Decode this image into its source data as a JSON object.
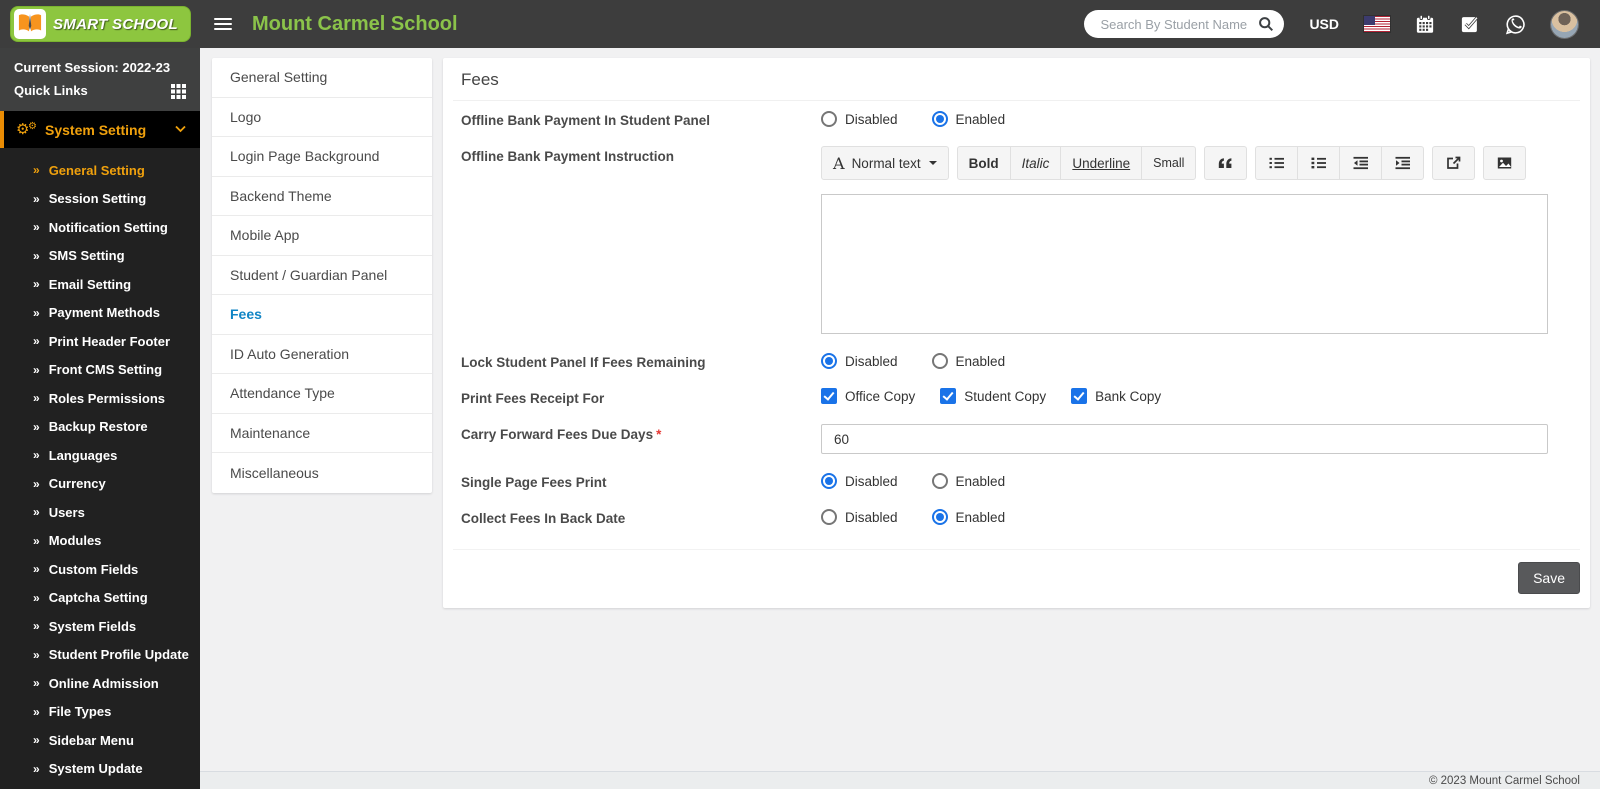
{
  "colors": {
    "header_bg": "#3d3d3d",
    "brand_green": "#8dc63f",
    "brand_orange": "#f7941e",
    "sidebar_bg": "#212121",
    "sidebar_accent_orange": "#f0a10d",
    "nav_active_blue": "#1185c5",
    "control_blue": "#1a73e8",
    "save_button_bg": "#58595b"
  },
  "header": {
    "brand": "SMART SCHOOL",
    "school_name": "Mount Carmel School",
    "search_placeholder": "Search By Student Name",
    "currency": "USD"
  },
  "sidebar": {
    "session_label": "Current Session: 2022-23",
    "quick_links_label": "Quick Links",
    "menu_title": "System Setting",
    "item_bullet": "»",
    "items": [
      {
        "label": "General Setting",
        "active": true
      },
      {
        "label": "Session Setting"
      },
      {
        "label": "Notification Setting"
      },
      {
        "label": "SMS Setting"
      },
      {
        "label": "Email Setting"
      },
      {
        "label": "Payment Methods"
      },
      {
        "label": "Print Header Footer"
      },
      {
        "label": "Front CMS Setting"
      },
      {
        "label": "Roles Permissions"
      },
      {
        "label": "Backup Restore"
      },
      {
        "label": "Languages"
      },
      {
        "label": "Currency"
      },
      {
        "label": "Users"
      },
      {
        "label": "Modules"
      },
      {
        "label": "Custom Fields"
      },
      {
        "label": "Captcha Setting"
      },
      {
        "label": "System Fields"
      },
      {
        "label": "Student Profile Update"
      },
      {
        "label": "Online Admission"
      },
      {
        "label": "File Types"
      },
      {
        "label": "Sidebar Menu"
      },
      {
        "label": "System Update"
      }
    ]
  },
  "settings_nav": {
    "items": [
      {
        "label": "General Setting"
      },
      {
        "label": "Logo"
      },
      {
        "label": "Login Page Background"
      },
      {
        "label": "Backend Theme"
      },
      {
        "label": "Mobile App"
      },
      {
        "label": "Student / Guardian Panel"
      },
      {
        "label": "Fees",
        "active": true
      },
      {
        "label": "ID Auto Generation"
      },
      {
        "label": "Attendance Type"
      },
      {
        "label": "Maintenance"
      },
      {
        "label": "Miscellaneous"
      }
    ]
  },
  "main": {
    "card_title": "Fees",
    "fields": {
      "offline_bank_payment": {
        "label": "Offline Bank Payment In Student Panel",
        "options": [
          "Disabled",
          "Enabled"
        ],
        "selected": "Enabled"
      },
      "offline_instruction": {
        "label": "Offline Bank Payment Instruction",
        "value": ""
      },
      "lock_student_panel": {
        "label": "Lock Student Panel If Fees Remaining",
        "options": [
          "Disabled",
          "Enabled"
        ],
        "selected": "Disabled"
      },
      "print_fees_receipt": {
        "label": "Print Fees Receipt For",
        "options": [
          "Office Copy",
          "Student Copy",
          "Bank Copy"
        ],
        "checked": [
          "Office Copy",
          "Student Copy",
          "Bank Copy"
        ]
      },
      "carry_forward_days": {
        "label": "Carry Forward Fees Due Days",
        "required_mark": "*",
        "value": "60"
      },
      "single_page_print": {
        "label": "Single Page Fees Print",
        "options": [
          "Disabled",
          "Enabled"
        ],
        "selected": "Disabled"
      },
      "collect_back_date": {
        "label": "Collect Fees In Back Date",
        "options": [
          "Disabled",
          "Enabled"
        ],
        "selected": "Enabled"
      }
    },
    "editor": {
      "style_icon": "A",
      "style_button": "Normal text",
      "bold": "Bold",
      "italic": "Italic",
      "underline": "Underline",
      "small": "Small"
    },
    "save_label": "Save"
  },
  "footer": {
    "copyright": "© 2023 Mount Carmel School"
  }
}
